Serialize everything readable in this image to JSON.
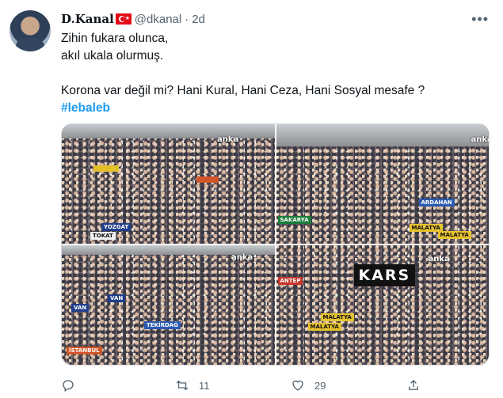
{
  "user": {
    "name": "D.Kanal",
    "handle": "@dkanal",
    "separator": "·",
    "time": "2d"
  },
  "menu_icon": "more-icon",
  "tweet": {
    "line1": "Zihin fukara olunca,",
    "line2": "akıl ukala olurmuş.",
    "line3": "Korona var değil mi? Hani Kural, Hani Ceza, Hani Sosyal mesafe ?",
    "hashtag": "#lebaleb"
  },
  "media": {
    "watermarks": [
      "anka",
      "anka",
      "anka",
      "anka"
    ],
    "banners_tl": [
      "YOZGAT",
      "TOKAT"
    ],
    "banners_tr": [
      "SAKARYA",
      "MALATYA",
      "MALATYA",
      "ARDAHAN"
    ],
    "banners_bl": [
      "VAN",
      "VAN",
      "TEKİRDAĞ",
      "İSTANBUL"
    ],
    "banners_br": [
      "KARS",
      "ANTEP",
      "MALATYA",
      "MALATYA"
    ]
  },
  "actions": {
    "reply_count": "",
    "retweet_count": "11",
    "like_count": "29"
  },
  "colors": {
    "accent": "#1d9bf0",
    "text": "#0f1419",
    "muted": "#536471",
    "flag": "#e30a17"
  }
}
